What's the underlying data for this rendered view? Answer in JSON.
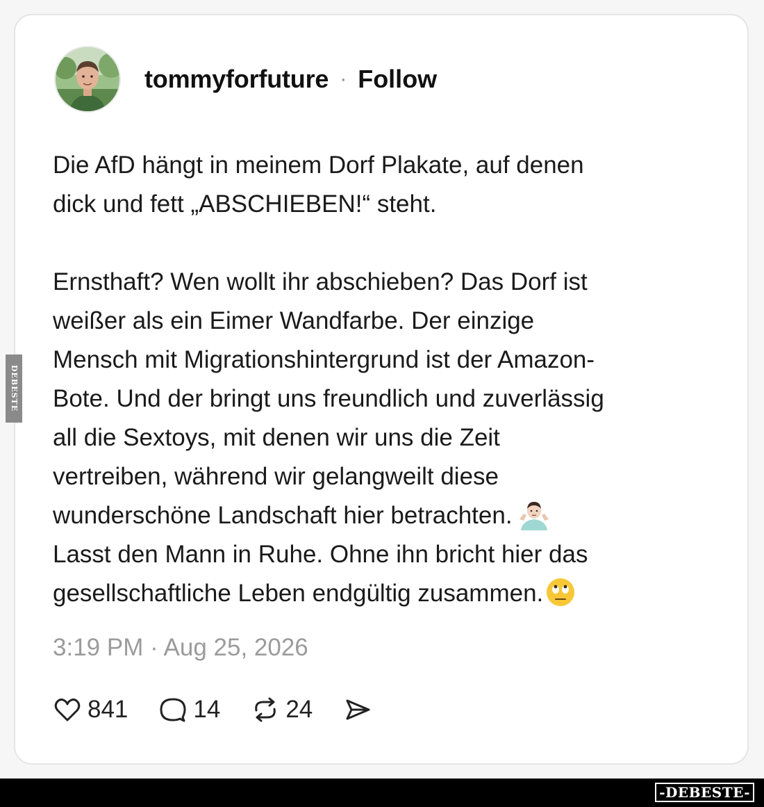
{
  "post": {
    "username": "tommyforfuture",
    "separator": "·",
    "follow_label": "Follow",
    "avatar_icon": "profile-photo",
    "paragraphs": [
      [
        "Die AfD hängt in meinem Dorf Plakate, auf denen",
        "dick und fett „ABSCHIEBEN!“ steht."
      ],
      [
        "Ernsthaft? Wen wollt ihr abschieben? Das Dorf ist",
        "weißer als ein Eimer Wandfarbe. Der einzige",
        "Mensch mit Migrationshintergrund ist der Amazon-",
        "Bote. Und der bringt uns freundlich und zuverlässig",
        "all die Sextoys, mit denen wir uns die Zeit",
        "vertreiben, während wir gelangweilt diese",
        "wunderschöne Landschaft hier betrachten.",
        "Lasst den Mann in Ruhe. Ohne ihn bricht hier das",
        "gesellschaftliche Leben endgültig zusammen."
      ]
    ],
    "emojis": {
      "shrug": "shrug-emoji",
      "eye_roll": "eye-roll-emoji"
    },
    "timestamp": "3:19 PM · Aug 25, 2026",
    "actions": {
      "likes": "841",
      "replies": "14",
      "reposts": "24",
      "like_icon": "heart-icon",
      "reply_icon": "comment-icon",
      "repost_icon": "repost-icon",
      "share_icon": "send-icon"
    }
  },
  "watermark": {
    "brand": "-DEBESTE-",
    "side": "DEBESTE"
  }
}
